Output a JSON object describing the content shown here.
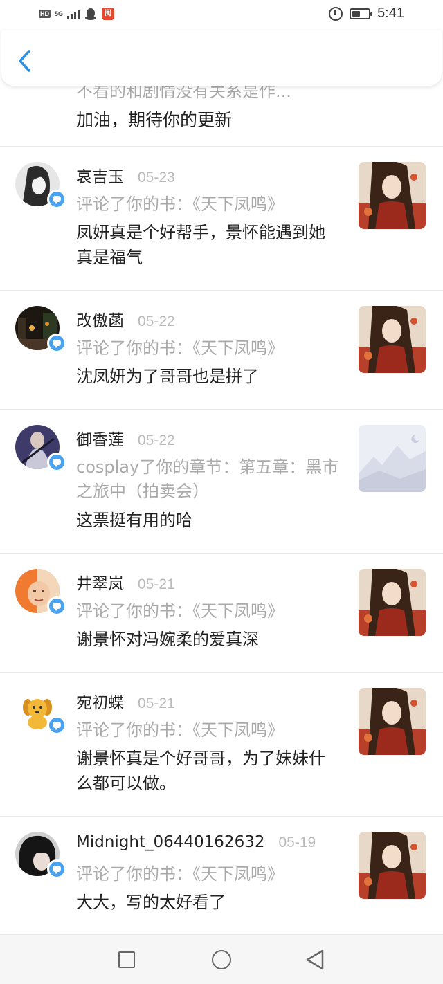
{
  "status_bar": {
    "network_label": "HD",
    "signal_label": "5G",
    "time": "5:41",
    "battery_level": 0.5
  },
  "navbar": {
    "back_icon": "chevron-left-icon"
  },
  "partial_item": {
    "cut_text": "不看的和剧情没有关系是作...",
    "comment": "加油，期待你的更新"
  },
  "items": [
    {
      "username": "哀吉玉",
      "date": "05-23",
      "subtitle": "评论了你的书：《天下凤鸣》",
      "comment": "凤妍真是个好帮手，景怀能遇到她真是福气",
      "avatar": "avatar-girl-bw",
      "thumb": "book-cover"
    },
    {
      "username": "改傲菡",
      "date": "05-22",
      "subtitle": "评论了你的书：《天下凤鸣》",
      "comment": "沈凤妍为了哥哥也是拼了",
      "avatar": "avatar-night-street",
      "thumb": "book-cover"
    },
    {
      "username": "御香莲",
      "date": "05-22",
      "subtitle": "cosplay了你的章节：第五章：黑市之旅中（拍卖会）",
      "comment": "这票挺有用的哈",
      "avatar": "avatar-swordsman",
      "thumb": "placeholder-landscape"
    },
    {
      "username": "井翠岚",
      "date": "05-21",
      "subtitle": "评论了你的书：《天下凤鸣》",
      "comment": "谢景怀对冯婉柔的爱真深",
      "avatar": "avatar-baby",
      "thumb": "book-cover"
    },
    {
      "username": "宛初蝶",
      "date": "05-21",
      "subtitle": "评论了你的书：《天下凤鸣》",
      "comment": "谢景怀真是个好哥哥，为了妹妹什么都可以做。",
      "avatar": "avatar-dog",
      "thumb": "book-cover"
    },
    {
      "username": "Midnight_06440162632",
      "date": "05-19",
      "subtitle": "评论了你的书：《天下凤鸣》",
      "comment": "大大，写的太好看了",
      "avatar": "avatar-dark-hair",
      "thumb": "book-cover"
    }
  ],
  "colors": {
    "accent": "#4aa3f0",
    "muted_text": "#aaaaaa",
    "divider": "#e8e8e8"
  }
}
